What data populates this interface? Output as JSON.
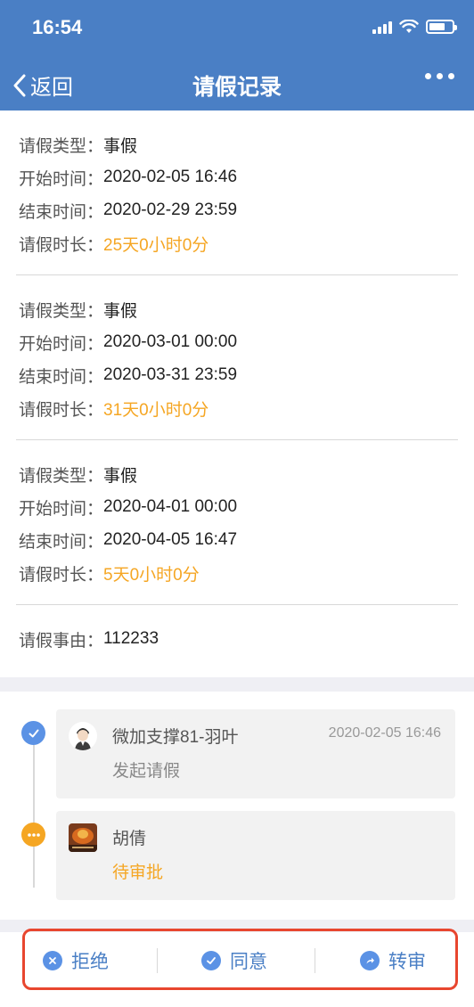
{
  "status_bar": {
    "time": "16:54"
  },
  "nav": {
    "back_label": "返回",
    "title": "请假记录"
  },
  "records": [
    {
      "type_label": "请假类型：",
      "type": "事假",
      "start_label": "开始时间：",
      "start": "2020-02-05 16:46",
      "end_label": "结束时间：",
      "end": "2020-02-29 23:59",
      "duration_label": "请假时长：",
      "duration": "25天0小时0分"
    },
    {
      "type_label": "请假类型：",
      "type": "事假",
      "start_label": "开始时间：",
      "start": "2020-03-01 00:00",
      "end_label": "结束时间：",
      "end": "2020-03-31 23:59",
      "duration_label": "请假时长：",
      "duration": "31天0小时0分"
    },
    {
      "type_label": "请假类型：",
      "type": "事假",
      "start_label": "开始时间：",
      "start": "2020-04-01 00:00",
      "end_label": "结束时间：",
      "end": "2020-04-05 16:47",
      "duration_label": "请假时长：",
      "duration": "5天0小时0分"
    }
  ],
  "reason": {
    "label": "请假事由：",
    "value": "112233"
  },
  "timeline": [
    {
      "name": "微加支撑81-羽叶",
      "time": "2020-02-05 16:46",
      "action": "发起请假",
      "status": "done"
    },
    {
      "name": "胡倩",
      "time": "",
      "action": "待审批",
      "status": "pending"
    }
  ],
  "actions": {
    "reject": "拒绝",
    "approve": "同意",
    "transfer": "转审"
  },
  "colors": {
    "brand": "#4a7fc5",
    "accent": "#f5a623",
    "highlight": "#e8462f"
  }
}
